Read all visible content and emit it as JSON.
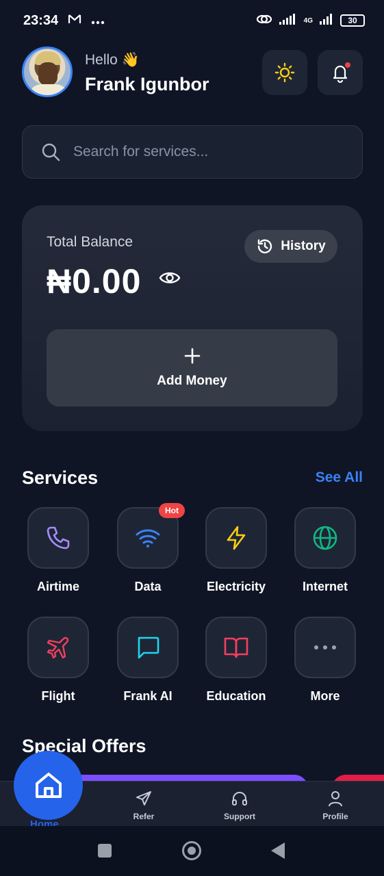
{
  "status_bar": {
    "time": "23:34",
    "network": "4G",
    "battery": "30"
  },
  "header": {
    "greeting": "Hello 👋",
    "user_name": "Frank Igunbor"
  },
  "search": {
    "placeholder": "Search for services..."
  },
  "balance": {
    "label": "Total Balance",
    "amount": "₦0.00",
    "history_label": "History",
    "add_money_label": "Add Money"
  },
  "services": {
    "title": "Services",
    "see_all": "See All",
    "hot_badge": "Hot",
    "items": [
      {
        "label": "Airtime",
        "icon": "phone-icon",
        "color": "#a78bfa"
      },
      {
        "label": "Data",
        "icon": "wifi-icon",
        "color": "#3b82f6"
      },
      {
        "label": "Electricity",
        "icon": "lightning-icon",
        "color": "#facc15"
      },
      {
        "label": "Internet",
        "icon": "globe-icon",
        "color": "#10b981"
      },
      {
        "label": "Flight",
        "icon": "plane-icon",
        "color": "#f43f5e"
      },
      {
        "label": "Frank AI",
        "icon": "chat-icon",
        "color": "#22d3ee"
      },
      {
        "label": "Education",
        "icon": "book-icon",
        "color": "#f43f5e"
      },
      {
        "label": "More",
        "icon": "more-icon",
        "color": "#9ca3af"
      }
    ]
  },
  "offers": {
    "title": "Special Offers"
  },
  "bottom_nav": {
    "home": "Home",
    "refer": "Refer",
    "support": "Support",
    "profile": "Profile"
  },
  "colors": {
    "accent": "#2563eb",
    "background": "#0f1525",
    "card": "#1e2636"
  }
}
